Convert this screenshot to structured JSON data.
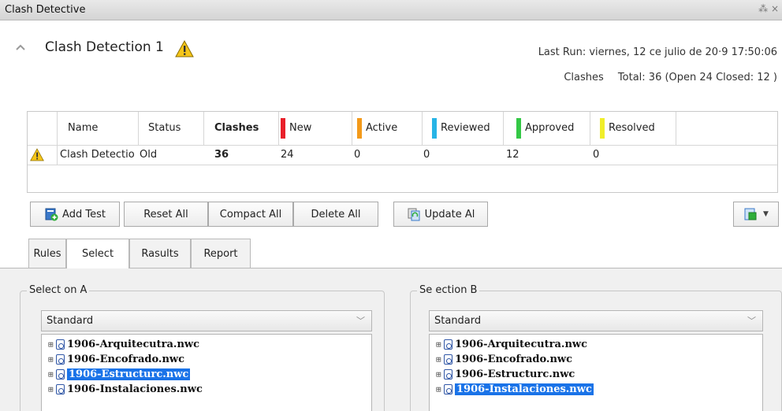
{
  "window": {
    "title": "Clash Detective",
    "controls": "⁂ ×"
  },
  "test": {
    "name": "Clash Detection 1",
    "last_run": "Last Run:  viernes, 12 ce julio de 20·9 17:50:06",
    "clashes_label": "Clashes",
    "total": "Total: 36  (Open  24  Closed:  12 )"
  },
  "grid": {
    "headers": {
      "name": "Name",
      "status": "Status",
      "clashes": "Clashes",
      "new": "New",
      "active": "Active",
      "reviewed": "Reviewed",
      "approved": "Approved",
      "resolved": "Resolved"
    },
    "status_colors": {
      "new": "#e8202a",
      "active": "#f39a1a",
      "reviewed": "#27b4e6",
      "approved": "#34c846",
      "resolved": "#f0ee2a"
    },
    "rows": [
      {
        "name": "Clash Detectio",
        "status": "Old",
        "clashes": "36",
        "new": "24",
        "active": "0",
        "reviewed": "0",
        "approved": "12",
        "resolved": "0"
      }
    ]
  },
  "toolbar": {
    "add_test": "Add Test",
    "reset_all": "Reset All",
    "compact_all": "Compact All",
    "delete_all": "Delete All",
    "update_all": "Update Al"
  },
  "tabs": [
    "Rules",
    "Select",
    "Rasults",
    "Report"
  ],
  "selection_a": {
    "label": "Select on A",
    "dropdown": "Standard",
    "items": [
      "1906-Arquitecutra.nwc",
      "1906-Encofrado.nwc",
      "1906-Estructurc.nwc",
      "1906-Instalaciones.nwc"
    ],
    "selected_index": 2
  },
  "selection_b": {
    "label": "Se ection B",
    "dropdown": "Standard",
    "items": [
      "1906-Arquitecutra.nwc",
      "1906-Encofrado.nwc",
      "1906-Estructurc.nwc",
      "1906-Instalaciones.nwc"
    ],
    "selected_index": 3
  },
  "accent_color": "#1a73e8"
}
